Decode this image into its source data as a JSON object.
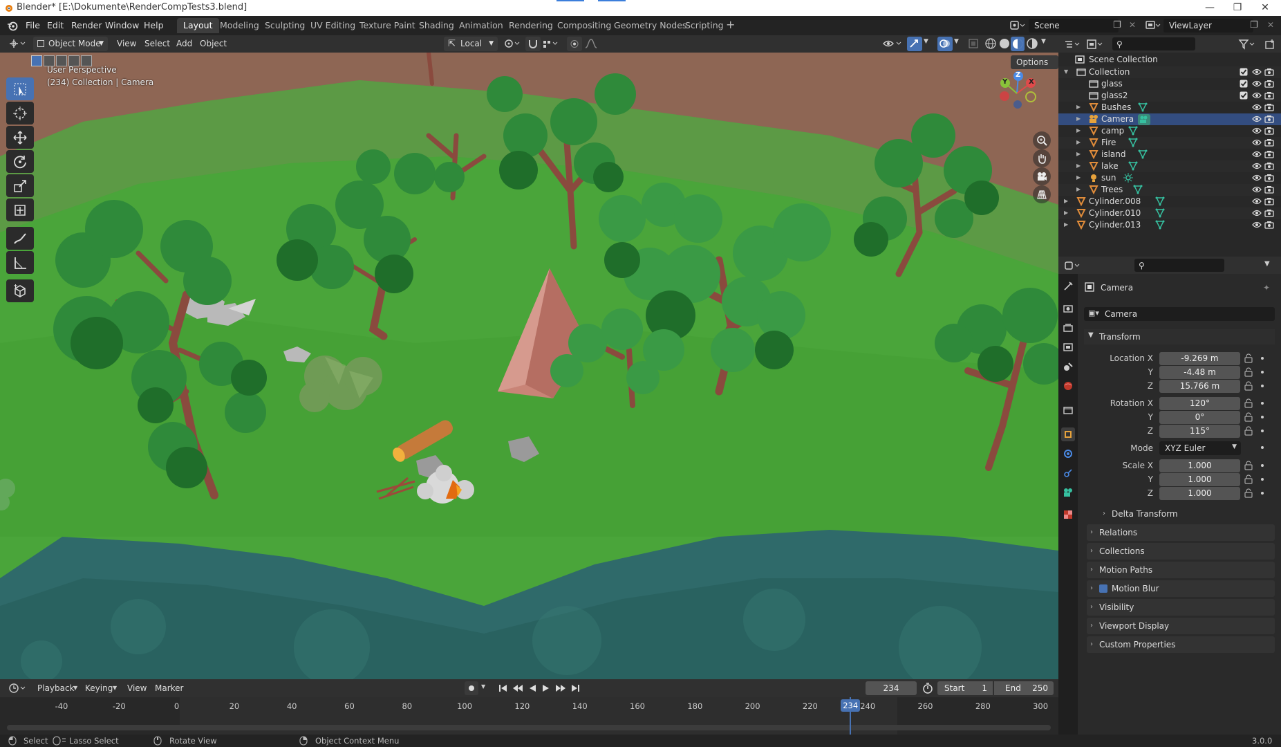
{
  "window": {
    "title": "Blender* [E:\\Dokumente\\RenderCompTests3.blend]"
  },
  "menu": [
    "File",
    "Edit",
    "Render",
    "Window",
    "Help"
  ],
  "workspaces": [
    {
      "label": "Layout",
      "active": true
    },
    {
      "label": "Modeling"
    },
    {
      "label": "Sculpting"
    },
    {
      "label": "UV Editing"
    },
    {
      "label": "Texture Paint"
    },
    {
      "label": "Shading"
    },
    {
      "label": "Animation"
    },
    {
      "label": "Rendering"
    },
    {
      "label": "Compositing"
    },
    {
      "label": "Geometry Nodes"
    },
    {
      "label": "Scripting"
    }
  ],
  "scene": {
    "name": "Scene"
  },
  "view_layer": {
    "name": "ViewLayer"
  },
  "viewport_header": {
    "mode": "Object Mode",
    "menus": [
      "View",
      "Select",
      "Add",
      "Object"
    ],
    "orientation": "Local",
    "options": "Options"
  },
  "viewport": {
    "perspective": "User Perspective",
    "collection_info": "(234) Collection | Camera",
    "gizmo_axes": [
      "X",
      "Y",
      "Z"
    ]
  },
  "outliner": {
    "root": "Scene Collection",
    "items": [
      {
        "name": "Collection",
        "type": "collection",
        "indent": 1,
        "expanded": true
      },
      {
        "name": "glass",
        "type": "collection",
        "indent": 2
      },
      {
        "name": "glass2",
        "type": "collection",
        "indent": 2
      },
      {
        "name": "Bushes",
        "type": "mesh",
        "indent": 2
      },
      {
        "name": "Camera",
        "type": "camera",
        "indent": 2,
        "selected": true
      },
      {
        "name": "camp",
        "type": "mesh",
        "indent": 2
      },
      {
        "name": "Fire",
        "type": "mesh",
        "indent": 2
      },
      {
        "name": "island",
        "type": "mesh",
        "indent": 2
      },
      {
        "name": "lake",
        "type": "mesh",
        "indent": 2
      },
      {
        "name": "sun",
        "type": "light",
        "indent": 2
      },
      {
        "name": "Trees",
        "type": "mesh",
        "indent": 2
      },
      {
        "name": "Cylinder.008",
        "type": "mesh",
        "indent": 1
      },
      {
        "name": "Cylinder.010",
        "type": "mesh",
        "indent": 1
      },
      {
        "name": "Cylinder.013",
        "type": "mesh",
        "indent": 1
      }
    ]
  },
  "properties": {
    "object_name": "Camera",
    "datablock": "Camera",
    "transform_title": "Transform",
    "location": {
      "label": "Location X",
      "x": "-9.269 m",
      "y": "-4.48 m",
      "z": "15.766 m"
    },
    "rotation": {
      "label": "Rotation X",
      "x": "120°",
      "y": "0°",
      "z": "115°"
    },
    "mode": {
      "label": "Mode",
      "value": "XYZ Euler"
    },
    "scale": {
      "label": "Scale X",
      "x": "1.000",
      "y": "1.000",
      "z": "1.000"
    },
    "axis_y": "Y",
    "axis_z": "Z",
    "panels": [
      "Delta Transform",
      "Relations",
      "Collections",
      "Motion Paths",
      "Motion Blur",
      "Visibility",
      "Viewport Display",
      "Custom Properties"
    ]
  },
  "timeline": {
    "menus": [
      "Playback",
      "Keying",
      "View",
      "Marker"
    ],
    "current_frame": "234",
    "start_label": "Start",
    "start": "1",
    "end_label": "End",
    "end": "250",
    "ticks": [
      "-40",
      "-20",
      "0",
      "20",
      "40",
      "60",
      "80",
      "100",
      "120",
      "140",
      "160",
      "180",
      "200",
      "220",
      "240",
      "260",
      "280",
      "300"
    ]
  },
  "statusbar": {
    "select": "Select",
    "lasso": "Lasso Select",
    "rotate": "Rotate View",
    "context": "Object Context Menu",
    "version": "3.0.0"
  },
  "colors": {
    "accent": "#4772b3",
    "grass": "#4aa53a",
    "water": "#2f6a6a",
    "tent": "#c98477",
    "camera_icon": "#e6a23c",
    "mesh_icon": "#e08c3a",
    "data_icon": "#36c0a0"
  }
}
